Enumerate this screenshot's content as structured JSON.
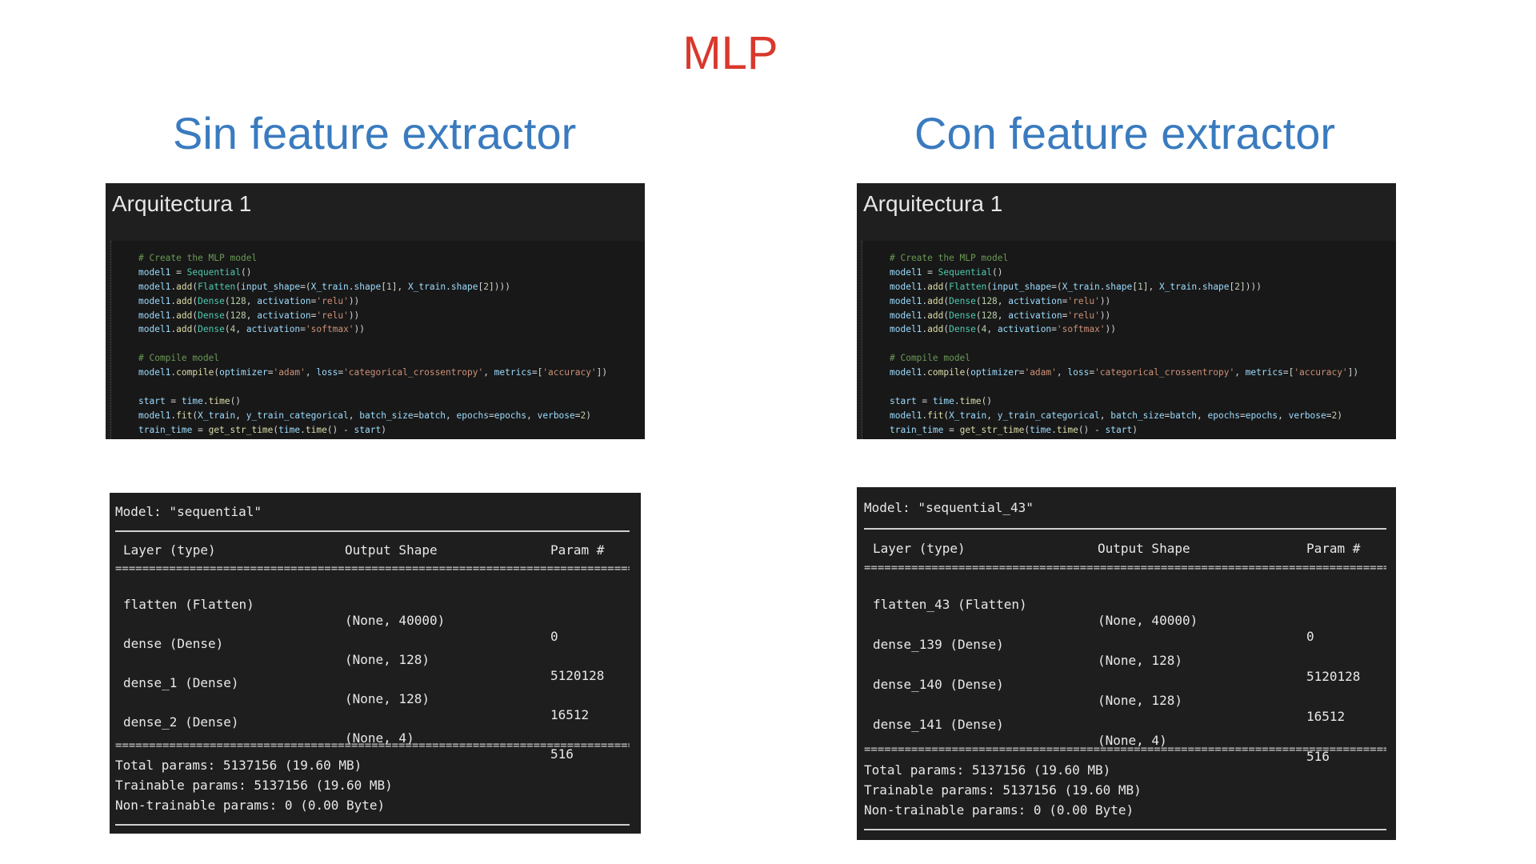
{
  "title": "MLP",
  "columns": [
    {
      "heading": "Sin feature extractor",
      "cell_title": "Arquitectura 1",
      "model_line": "Model: \"sequential\"",
      "headers": [
        "Layer (type)",
        "Output Shape",
        "Param #"
      ],
      "layers": [
        {
          "name": "flatten (Flatten)",
          "shape": "(None, 40000)",
          "params": "0"
        },
        {
          "name": "dense (Dense)",
          "shape": "(None, 128)",
          "params": "5120128"
        },
        {
          "name": "dense_1 (Dense)",
          "shape": "(None, 128)",
          "params": "16512"
        },
        {
          "name": "dense_2 (Dense)",
          "shape": "(None, 4)",
          "params": "516"
        }
      ],
      "totals": [
        "Total params: 5137156 (19.60 MB)",
        "Trainable params: 5137156 (19.60 MB)",
        "Non-trainable params: 0 (0.00 Byte)"
      ]
    },
    {
      "heading": "Con feature extractor",
      "cell_title": "Arquitectura 1",
      "model_line": "Model: \"sequential_43\"",
      "headers": [
        "Layer (type)",
        "Output Shape",
        "Param #"
      ],
      "layers": [
        {
          "name": "flatten_43 (Flatten)",
          "shape": "(None, 40000)",
          "params": "0"
        },
        {
          "name": "dense_139 (Dense)",
          "shape": "(None, 128)",
          "params": "5120128"
        },
        {
          "name": "dense_140 (Dense)",
          "shape": "(None, 128)",
          "params": "16512"
        },
        {
          "name": "dense_141 (Dense)",
          "shape": "(None, 4)",
          "params": "516"
        }
      ],
      "totals": [
        "Total params: 5137156 (19.60 MB)",
        "Trainable params: 5137156 (19.60 MB)",
        "Non-trainable params: 0 (0.00 Byte)"
      ]
    }
  ],
  "code_lines": [
    [
      [
        "com",
        "# Create the MLP model"
      ]
    ],
    [
      [
        "var",
        "model1"
      ],
      [
        "pun",
        " = "
      ],
      [
        "cls",
        "Sequential"
      ],
      [
        "pun",
        "()"
      ]
    ],
    [
      [
        "var",
        "model1"
      ],
      [
        "pun",
        "."
      ],
      [
        "fn",
        "add"
      ],
      [
        "pun",
        "("
      ],
      [
        "cls",
        "Flatten"
      ],
      [
        "pun",
        "("
      ],
      [
        "var",
        "input_shape"
      ],
      [
        "pun",
        "=("
      ],
      [
        "var",
        "X_train"
      ],
      [
        "pun",
        "."
      ],
      [
        "var",
        "shape"
      ],
      [
        "pun",
        "["
      ],
      [
        "num",
        "1"
      ],
      [
        "pun",
        "], "
      ],
      [
        "var",
        "X_train"
      ],
      [
        "pun",
        "."
      ],
      [
        "var",
        "shape"
      ],
      [
        "pun",
        "["
      ],
      [
        "num",
        "2"
      ],
      [
        "pun",
        "])))"
      ]
    ],
    [
      [
        "var",
        "model1"
      ],
      [
        "pun",
        "."
      ],
      [
        "fn",
        "add"
      ],
      [
        "pun",
        "("
      ],
      [
        "cls",
        "Dense"
      ],
      [
        "pun",
        "("
      ],
      [
        "num",
        "128"
      ],
      [
        "pun",
        ", "
      ],
      [
        "var",
        "activation"
      ],
      [
        "pun",
        "="
      ],
      [
        "str",
        "'relu'"
      ],
      [
        "pun",
        "))"
      ]
    ],
    [
      [
        "var",
        "model1"
      ],
      [
        "pun",
        "."
      ],
      [
        "fn",
        "add"
      ],
      [
        "pun",
        "("
      ],
      [
        "cls",
        "Dense"
      ],
      [
        "pun",
        "("
      ],
      [
        "num",
        "128"
      ],
      [
        "pun",
        ", "
      ],
      [
        "var",
        "activation"
      ],
      [
        "pun",
        "="
      ],
      [
        "str",
        "'relu'"
      ],
      [
        "pun",
        "))"
      ]
    ],
    [
      [
        "var",
        "model1"
      ],
      [
        "pun",
        "."
      ],
      [
        "fn",
        "add"
      ],
      [
        "pun",
        "("
      ],
      [
        "cls",
        "Dense"
      ],
      [
        "pun",
        "("
      ],
      [
        "num",
        "4"
      ],
      [
        "pun",
        ", "
      ],
      [
        "var",
        "activation"
      ],
      [
        "pun",
        "="
      ],
      [
        "str",
        "'softmax'"
      ],
      [
        "pun",
        "))"
      ]
    ],
    [],
    [
      [
        "com",
        "# Compile model"
      ]
    ],
    [
      [
        "var",
        "model1"
      ],
      [
        "pun",
        "."
      ],
      [
        "fn",
        "compile"
      ],
      [
        "pun",
        "("
      ],
      [
        "var",
        "optimizer"
      ],
      [
        "pun",
        "="
      ],
      [
        "str",
        "'adam'"
      ],
      [
        "pun",
        ", "
      ],
      [
        "var",
        "loss"
      ],
      [
        "pun",
        "="
      ],
      [
        "str",
        "'categorical_crossentropy'"
      ],
      [
        "pun",
        ", "
      ],
      [
        "var",
        "metrics"
      ],
      [
        "pun",
        "=["
      ],
      [
        "str",
        "'accuracy'"
      ],
      [
        "pun",
        "])"
      ]
    ],
    [],
    [
      [
        "var",
        "start"
      ],
      [
        "pun",
        " = "
      ],
      [
        "var",
        "time"
      ],
      [
        "pun",
        "."
      ],
      [
        "fn",
        "time"
      ],
      [
        "pun",
        "()"
      ]
    ],
    [
      [
        "var",
        "model1"
      ],
      [
        "pun",
        "."
      ],
      [
        "fn",
        "fit"
      ],
      [
        "pun",
        "("
      ],
      [
        "var",
        "X_train"
      ],
      [
        "pun",
        ", "
      ],
      [
        "var",
        "y_train_categorical"
      ],
      [
        "pun",
        ", "
      ],
      [
        "var",
        "batch_size"
      ],
      [
        "pun",
        "="
      ],
      [
        "var",
        "batch"
      ],
      [
        "pun",
        ", "
      ],
      [
        "var",
        "epochs"
      ],
      [
        "pun",
        "="
      ],
      [
        "var",
        "epochs"
      ],
      [
        "pun",
        ", "
      ],
      [
        "var",
        "verbose"
      ],
      [
        "pun",
        "="
      ],
      [
        "num",
        "2"
      ],
      [
        "pun",
        ")"
      ]
    ],
    [
      [
        "var",
        "train_time"
      ],
      [
        "pun",
        " = "
      ],
      [
        "fn",
        "get_str_time"
      ],
      [
        "pun",
        "("
      ],
      [
        "var",
        "time"
      ],
      [
        "pun",
        "."
      ],
      [
        "fn",
        "time"
      ],
      [
        "pun",
        "() - "
      ],
      [
        "var",
        "start"
      ],
      [
        "pun",
        ")"
      ]
    ]
  ],
  "colors": {
    "title": "#d9382c",
    "heading": "#3a7bbf",
    "panel_bg": "#1e1e1e",
    "code_bg": "#181818"
  }
}
